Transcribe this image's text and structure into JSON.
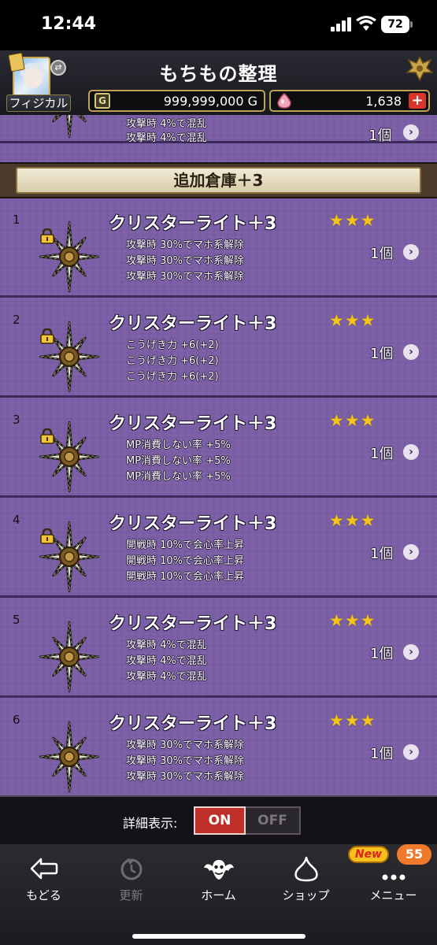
{
  "status_bar": {
    "time": "12:44",
    "battery": "72"
  },
  "header": {
    "title": "もちもの整理",
    "role": "フィジカル",
    "gold_icon": "G",
    "gold": "999,999,000 G",
    "gems": "1,638",
    "gem_plus": "+"
  },
  "partial_row": {
    "effects": [
      "攻撃時 4%で混乱",
      "攻撃時 4%で混乱"
    ],
    "count": "1個"
  },
  "section": {
    "title": "追加倉庫＋3"
  },
  "items": [
    {
      "index": "1",
      "name": "クリスターライト＋3",
      "locked": true,
      "stars": "★★★",
      "count": "1個",
      "effects": [
        "攻撃時 30%でマホ系解除",
        "攻撃時 30%でマホ系解除",
        "攻撃時 30%でマホ系解除"
      ]
    },
    {
      "index": "2",
      "name": "クリスターライト＋3",
      "locked": true,
      "stars": "★★★",
      "count": "1個",
      "effects": [
        "こうげき力 +6(+2)",
        "こうげき力 +6(+2)",
        "こうげき力 +6(+2)"
      ]
    },
    {
      "index": "3",
      "name": "クリスターライト＋3",
      "locked": true,
      "stars": "★★★",
      "count": "1個",
      "effects": [
        "MP消費しない率 +5%",
        "MP消費しない率 +5%",
        "MP消費しない率 +5%"
      ]
    },
    {
      "index": "4",
      "name": "クリスターライト＋3",
      "locked": true,
      "stars": "★★★",
      "count": "1個",
      "effects": [
        "開戦時 10%で会心率上昇",
        "開戦時 10%で会心率上昇",
        "開戦時 10%で会心率上昇"
      ]
    },
    {
      "index": "5",
      "name": "クリスターライト＋3",
      "locked": false,
      "stars": "★★★",
      "count": "1個",
      "effects": [
        "攻撃時 4%で混乱",
        "攻撃時 4%で混乱",
        "攻撃時 4%で混乱"
      ]
    },
    {
      "index": "6",
      "name": "クリスターライト＋3",
      "locked": false,
      "stars": "★★★",
      "count": "1個",
      "effects": [
        "攻撃時 30%でマホ系解除",
        "攻撃時 30%でマホ系解除",
        "攻撃時 30%でマホ系解除"
      ]
    }
  ],
  "detail_toggle": {
    "label": "詳細表示:",
    "on": "ON",
    "off": "OFF",
    "selected": "ON"
  },
  "nav": {
    "items": [
      {
        "label": "もどる",
        "icon": "back-arrow-icon"
      },
      {
        "label": "更新",
        "icon": "refresh-icon"
      },
      {
        "label": "ホーム",
        "icon": "home-bat-icon"
      },
      {
        "label": "ショップ",
        "icon": "slime-icon"
      },
      {
        "label": "メニュー",
        "icon": "more-dots-icon"
      }
    ],
    "new_badge": "New",
    "count_badge": "55"
  },
  "colors": {
    "list_bg": "#7b5fa6",
    "star": "#f5c518",
    "toggle_on": "#bf2f2a",
    "header_border": "#bba35a"
  }
}
